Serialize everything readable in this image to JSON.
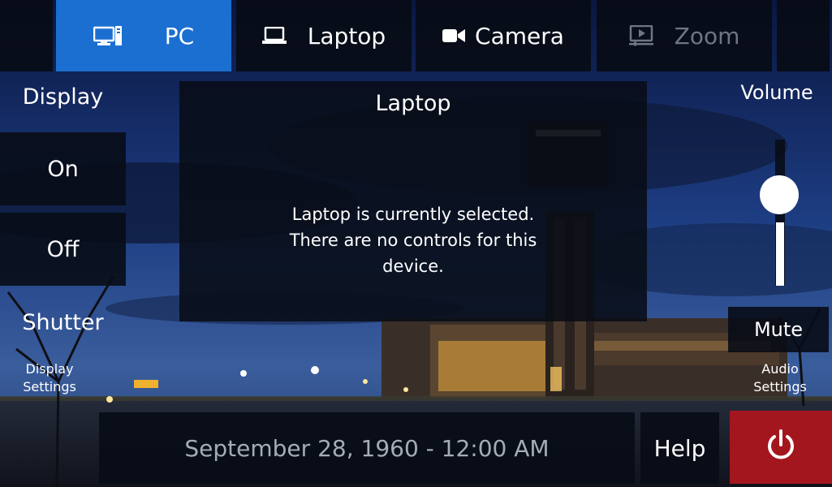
{
  "tabs": [
    {
      "label": "PC",
      "icon": "pc-icon",
      "state": "active"
    },
    {
      "label": "Laptop",
      "icon": "laptop-icon",
      "state": "normal"
    },
    {
      "label": "Camera",
      "icon": "camera-icon",
      "state": "normal"
    },
    {
      "label": "Zoom",
      "icon": "zoom-icon",
      "state": "disabled"
    }
  ],
  "display": {
    "title": "Display",
    "on_label": "On",
    "off_label": "Off",
    "shutter_label": "Shutter",
    "settings_line1": "Display",
    "settings_line2": "Settings"
  },
  "center": {
    "title": "Laptop",
    "message_lines": [
      "Laptop is currently selected.",
      "There are no controls for this",
      "device."
    ]
  },
  "volume": {
    "title": "Volume",
    "level_fraction": 0.62,
    "mute_label": "Mute",
    "settings_line1": "Audio",
    "settings_line2": "Settings"
  },
  "footer": {
    "datetime": "September 28, 1960 - 12:00 AM",
    "help_label": "Help",
    "power_icon": "power-icon"
  },
  "colors": {
    "active_tab": "#1b6fd1",
    "panel": "#080c16",
    "power": "#a4161e",
    "disabled_text": "#6f7682",
    "date_text": "#a4acb8"
  }
}
